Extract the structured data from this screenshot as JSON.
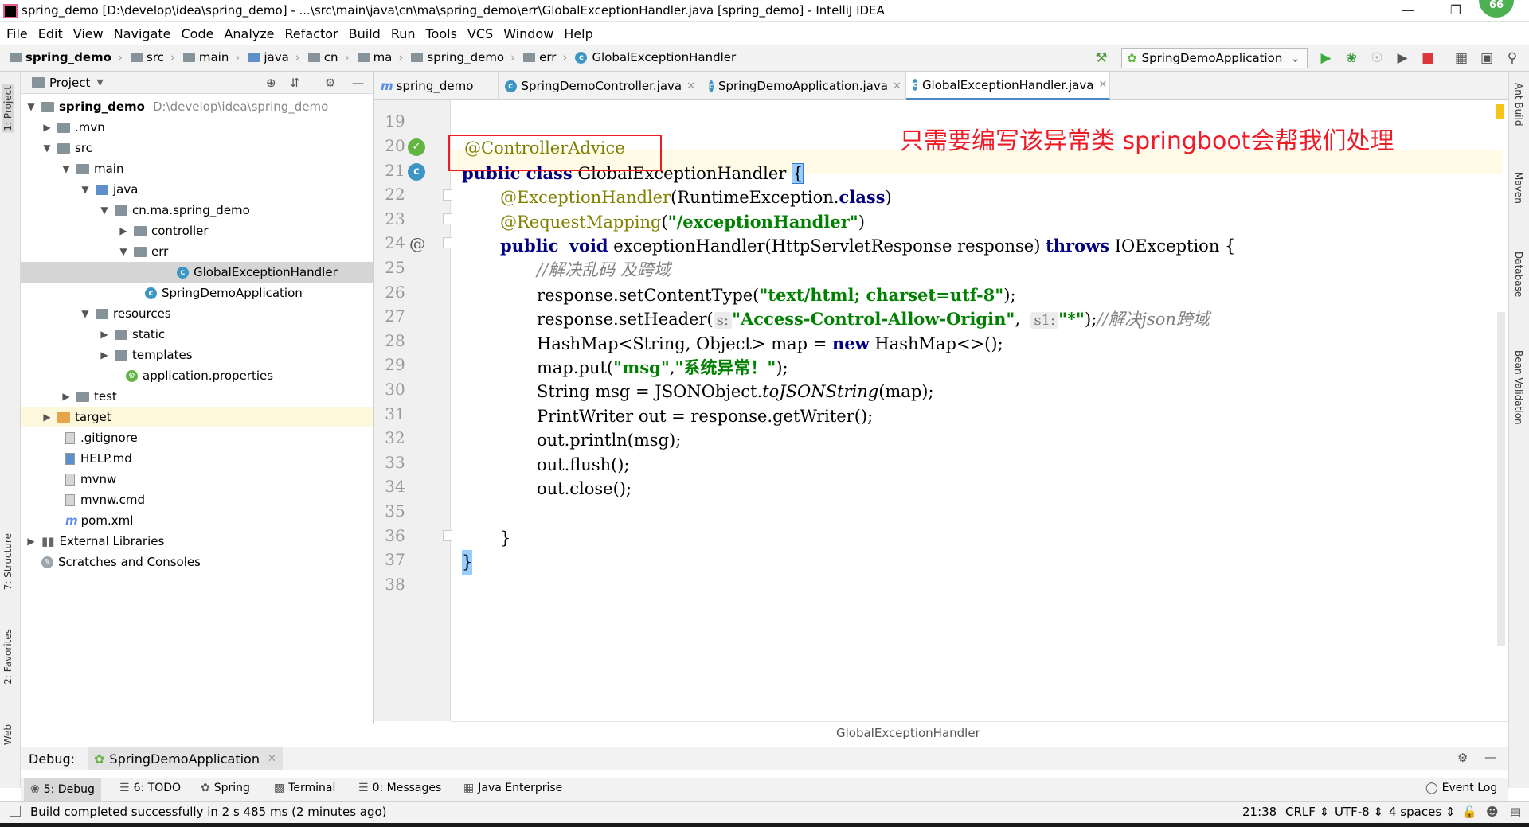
{
  "window": {
    "title": "spring_demo [D:\\develop\\idea\\spring_demo] - ...\\src\\main\\java\\cn\\ma\\spring_demo\\err\\GlobalExceptionHandler.java [spring_demo] - IntelliJ IDEA",
    "badge": "66"
  },
  "menu": [
    "File",
    "Edit",
    "View",
    "Navigate",
    "Code",
    "Analyze",
    "Refactor",
    "Build",
    "Run",
    "Tools",
    "VCS",
    "Window",
    "Help"
  ],
  "breadcrumbs": [
    "spring_demo",
    "src",
    "main",
    "java",
    "cn",
    "ma",
    "spring_demo",
    "err",
    "GlobalExceptionHandler"
  ],
  "run_config": "SpringDemoApplication",
  "project_panel": {
    "header": "Project",
    "root_name": "spring_demo",
    "root_path": "D:\\develop\\idea\\spring_demo",
    "nodes": [
      {
        "label": ".mvn"
      },
      {
        "label": "src"
      },
      {
        "label": "main"
      },
      {
        "label": "java"
      },
      {
        "label": "cn.ma.spring_demo"
      },
      {
        "label": "controller"
      },
      {
        "label": "err"
      },
      {
        "label": "GlobalExceptionHandler"
      },
      {
        "label": "SpringDemoApplication"
      },
      {
        "label": "resources"
      },
      {
        "label": "static"
      },
      {
        "label": "templates"
      },
      {
        "label": "application.properties"
      },
      {
        "label": "test"
      },
      {
        "label": "target"
      },
      {
        "label": ".gitignore"
      },
      {
        "label": "HELP.md"
      },
      {
        "label": "mvnw"
      },
      {
        "label": "mvnw.cmd"
      },
      {
        "label": "pom.xml"
      },
      {
        "label": "External Libraries"
      },
      {
        "label": "Scratches and Consoles"
      }
    ]
  },
  "tabs": [
    {
      "label": "spring_demo"
    },
    {
      "label": "SpringDemoController.java"
    },
    {
      "label": "SpringDemoApplication.java"
    },
    {
      "label": "GlobalExceptionHandler.java"
    }
  ],
  "editor": {
    "line_numbers": [
      "19",
      "20",
      "21",
      "22",
      "23",
      "24",
      "25",
      "26",
      "27",
      "28",
      "29",
      "30",
      "31",
      "32",
      "33",
      "34",
      "35",
      "36",
      "37",
      "38"
    ],
    "code": {
      "l20_ann": "@ControllerAdvice",
      "l21_kw": "public class",
      "l21_rest": " GlobalExceptionHandler ",
      "l21_brace": "{",
      "l22_ann": "@ExceptionHandler",
      "l22_rest": "(RuntimeException.",
      "l22_kw": "class",
      "l22_end": ")",
      "l23_ann": "@RequestMapping",
      "l23_open": "(",
      "l23_str": "\"/exceptionHandler\"",
      "l23_end": ")",
      "l24_kw1": "public",
      "l24_kw2": "void",
      "l24_mid": " exceptionHandler(HttpServletResponse response) ",
      "l24_kw3": "throws",
      "l24_end": " IOException {",
      "l25_cm": "//解决乱码 及跨域",
      "l26_pre": "response.setContentType(",
      "l26_str": "\"text/html; charset=utf-8\"",
      "l26_end": ");",
      "l27_pre": "response.setHeader(",
      "l27_hint1": "s:",
      "l27_str1": "\"Access-Control-Allow-Origin\"",
      "l27_comma": ", ",
      "l27_hint2": "s1:",
      "l27_str2": "\"*\"",
      "l27_end": ");",
      "l27_cm": "//解决json跨域",
      "l28_pre": "HashMap<String, Object> map = ",
      "l28_kw": "new",
      "l28_end": " HashMap<>();",
      "l29_pre": "map.put(",
      "l29_str1": "\"msg\"",
      "l29_comma": ",",
      "l29_str2": "\"系统异常！\"",
      "l29_end": ");",
      "l30_pre": "String msg = JSONObject.",
      "l30_it": "toJSONString",
      "l30_end": "(map);",
      "l31": "PrintWriter out = response.getWriter();",
      "l32": "out.println(msg);",
      "l33": "out.flush();",
      "l34": "out.close();",
      "l36": "}",
      "l37": "}"
    },
    "breadcrumb": "GlobalExceptionHandler"
  },
  "annotation_text": "只需要编写该异常类  springboot会帮我们处理",
  "left_strip": [
    "1: Project",
    "7: Structure",
    "2: Favorites",
    "Web"
  ],
  "right_strip": [
    "Ant Build",
    "Maven",
    "Database",
    "Bean Validation"
  ],
  "debug_bar": {
    "label": "Debug:",
    "config": "SpringDemoApplication"
  },
  "bottom_tabs": [
    "5: Debug",
    "6: TODO",
    "Spring",
    "Terminal",
    "0: Messages",
    "Java Enterprise"
  ],
  "event_log": "Event Log",
  "status": {
    "message": "Build completed successfully in 2 s 485 ms (2 minutes ago)",
    "position": "21:38",
    "line_sep": "CRLF",
    "encoding": "UTF-8",
    "indent": "4 spaces"
  }
}
